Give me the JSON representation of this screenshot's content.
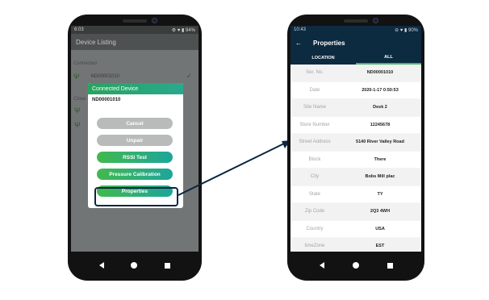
{
  "left_phone": {
    "status": {
      "time": "6:03",
      "icons": "⚙ ♥ ▮ 94%"
    },
    "header_title": "Device Listing",
    "background": {
      "section_connected": "Connected",
      "section_other": "Close",
      "device_id": "ND00001010"
    },
    "dialog": {
      "title": "Connected Device",
      "device_id": "ND00001010",
      "buttons": {
        "cancel": "Cancel",
        "unpair": "Unpair",
        "rssi_test": "RSSI Test",
        "pressure_calibration": "Pressure Calibration",
        "properties": "Properties"
      }
    }
  },
  "right_phone": {
    "status": {
      "time": "10:43",
      "icons": "⊖ ♥ ▮ 90%"
    },
    "title": "Properties",
    "back_icon": "←",
    "tabs": [
      "LOCATION",
      "ALL"
    ],
    "active_tab": "ALL",
    "properties": [
      {
        "label": "Ser. No.",
        "value": "ND00001010"
      },
      {
        "label": "Date",
        "value": "2020-1-17 0:50:53"
      },
      {
        "label": "Site Name",
        "value": "Desk 2"
      },
      {
        "label": "Store Number",
        "value": "12245678"
      },
      {
        "label": "Street Address",
        "value": "5140 River Valley Road"
      },
      {
        "label": "Block",
        "value": "There"
      },
      {
        "label": "City",
        "value": "Bobs Mill plac"
      },
      {
        "label": "State",
        "value": "TY"
      },
      {
        "label": "Zip Code",
        "value": "2Q3 4WH"
      },
      {
        "label": "Country",
        "value": "USA"
      },
      {
        "label": "timeZone",
        "value": "EST"
      }
    ]
  },
  "colors": {
    "navy": "#0c2a40",
    "green_start": "#42b94d",
    "green_end": "#1ea59b",
    "grey_button": "#b9bbbb"
  }
}
